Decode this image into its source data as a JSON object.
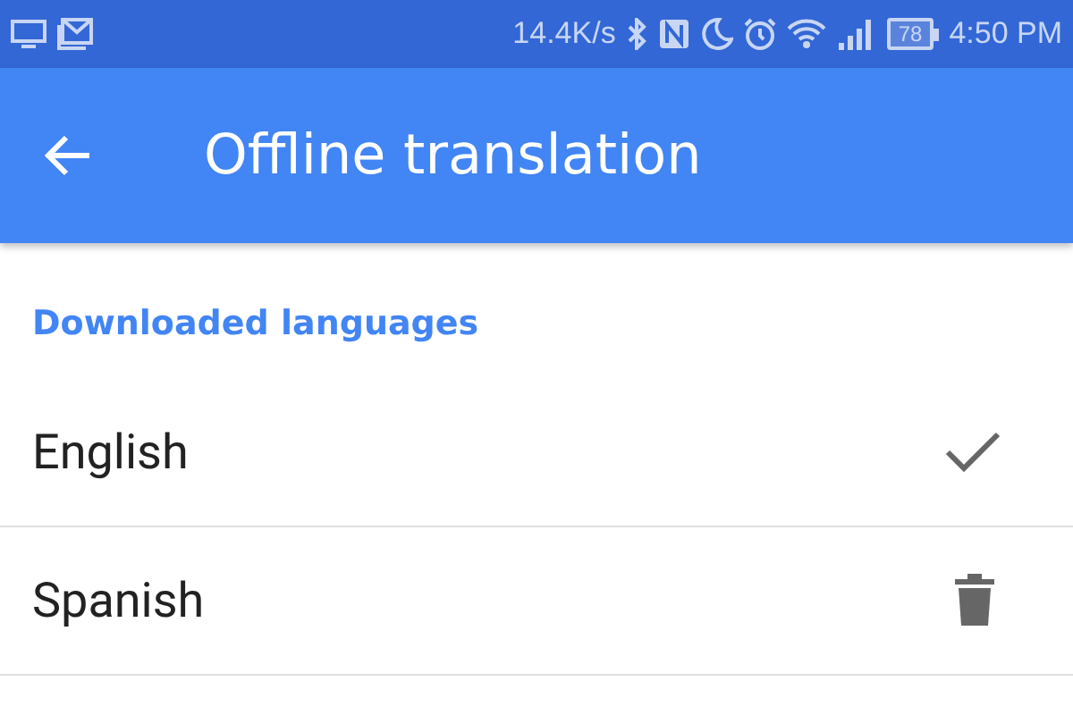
{
  "status_bar": {
    "speed": "14.4K/s",
    "battery": "78",
    "time": "4:50 PM"
  },
  "app_bar": {
    "title": "Offline translation"
  },
  "section": {
    "title": "Downloaded languages"
  },
  "languages": [
    {
      "name": "English",
      "kind": "default"
    },
    {
      "name": "Spanish",
      "kind": "removable"
    }
  ]
}
